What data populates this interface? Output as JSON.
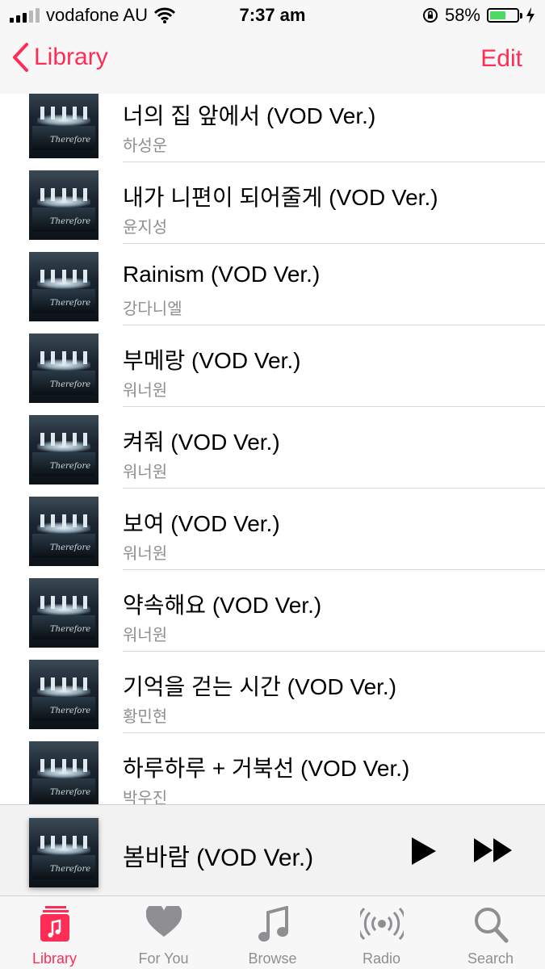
{
  "status_bar": {
    "carrier": "vodafone AU",
    "time": "7:37 am",
    "battery_percent": "58%",
    "battery_level": 0.58,
    "accent_color": "#4cd964"
  },
  "nav": {
    "back_label": "Library",
    "edit_label": "Edit",
    "accent_color": "#ff2d55"
  },
  "songs": [
    {
      "title": "너의 집 앞에서 (VOD Ver.)",
      "artist": "하성운"
    },
    {
      "title": "내가 니편이 되어줄게 (VOD Ver.)",
      "artist": "윤지성"
    },
    {
      "title": "Rainism (VOD Ver.)",
      "artist": "강다니엘"
    },
    {
      "title": "부메랑 (VOD Ver.)",
      "artist": "워너원"
    },
    {
      "title": "켜줘 (VOD Ver.)",
      "artist": "워너원"
    },
    {
      "title": "보여 (VOD Ver.)",
      "artist": "워너원"
    },
    {
      "title": "약속해요 (VOD Ver.)",
      "artist": "워너원"
    },
    {
      "title": "기억을 걷는 시간 (VOD Ver.)",
      "artist": "황민현"
    },
    {
      "title": "하루하루 + 거북선 (VOD Ver.)",
      "artist": "박우진"
    }
  ],
  "mini_player": {
    "title": "봄바람 (VOD Ver.)"
  },
  "tabs": [
    {
      "label": "Library",
      "icon": "music-note-square-icon",
      "active": true
    },
    {
      "label": "For You",
      "icon": "heart-icon",
      "active": false
    },
    {
      "label": "Browse",
      "icon": "music-note-icon",
      "active": false
    },
    {
      "label": "Radio",
      "icon": "radio-broadcast-icon",
      "active": false
    },
    {
      "label": "Search",
      "icon": "search-icon",
      "active": false
    }
  ]
}
